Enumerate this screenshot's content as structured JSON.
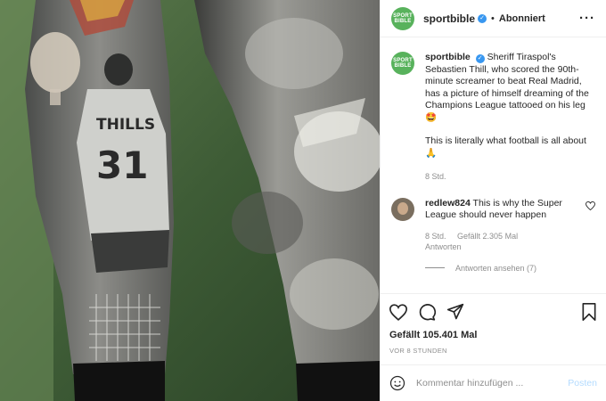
{
  "header": {
    "username": "sportbible",
    "separator": "•",
    "follow_label": "Abonniert",
    "more_label": "···",
    "avatar_text": "SPORT\nBIBLE"
  },
  "caption": {
    "username": "sportbible",
    "text": "Sheriff Tiraspol's Sebastien Thill, who scored the 90th-minute screamer to beat Real Madrid, has a picture of himself dreaming of the Champions League tattooed on his leg",
    "emoji1": "🤩",
    "text2": "This is literally what football is all about",
    "emoji2": "🙏",
    "time": "8 Std."
  },
  "comment": {
    "username": "redlew824",
    "text": "This is why the Super League should never happen",
    "time": "8 Std.",
    "likes": "Gefällt 2.305 Mal",
    "reply_label": "Antworten",
    "view_replies": "Antworten ansehen (7)"
  },
  "actions": {
    "likes": "Gefällt 105.401 Mal",
    "timestamp": "VOR 8 STUNDEN"
  },
  "add_comment": {
    "placeholder": "Kommentar hinzufügen ...",
    "post_label": "Posten"
  },
  "image": {
    "tattoo_name": "THILLS",
    "tattoo_number": "31"
  },
  "colors": {
    "accent": "#3897f0",
    "avatar_bg": "#58b25c"
  }
}
